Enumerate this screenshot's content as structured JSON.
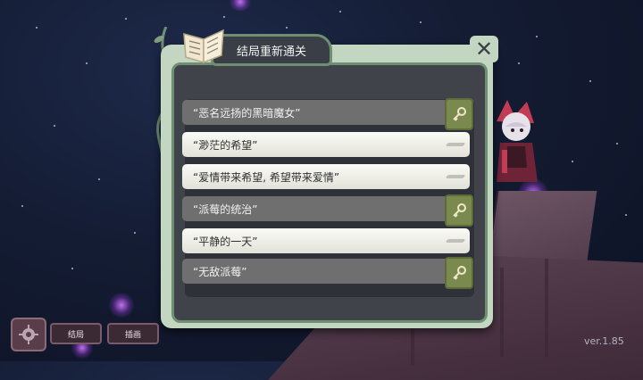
{
  "dialog": {
    "title": "结局重新通关",
    "close_label": "✕"
  },
  "endings": [
    {
      "label": "“恶名远扬的黑暗魔女”",
      "state": "locked"
    },
    {
      "label": "“渺茫的希望”",
      "state": "unlocked"
    },
    {
      "label": "“爱情带来希望, 希望带来爱情”",
      "state": "unlocked"
    },
    {
      "label": "“派莓的统治”",
      "state": "locked"
    },
    {
      "label": "“平静的一天”",
      "state": "unlocked"
    },
    {
      "label": "“无敌派莓”",
      "state": "locked"
    }
  ],
  "footer": {
    "ending_button": "结局",
    "illustration_button": "插画",
    "version": "ver.1.85"
  },
  "icons": {
    "book": "book-icon",
    "close": "close-icon",
    "key": "key-icon",
    "gear": "gear-icon"
  },
  "colors": {
    "frame": "#c3d6c1",
    "frame_border": "#6f8f72",
    "panel": "#40434a",
    "locked_row": "#6f6f6f",
    "unlocked_row": "#f4f4ee",
    "key_badge": "#7a8a4e"
  }
}
